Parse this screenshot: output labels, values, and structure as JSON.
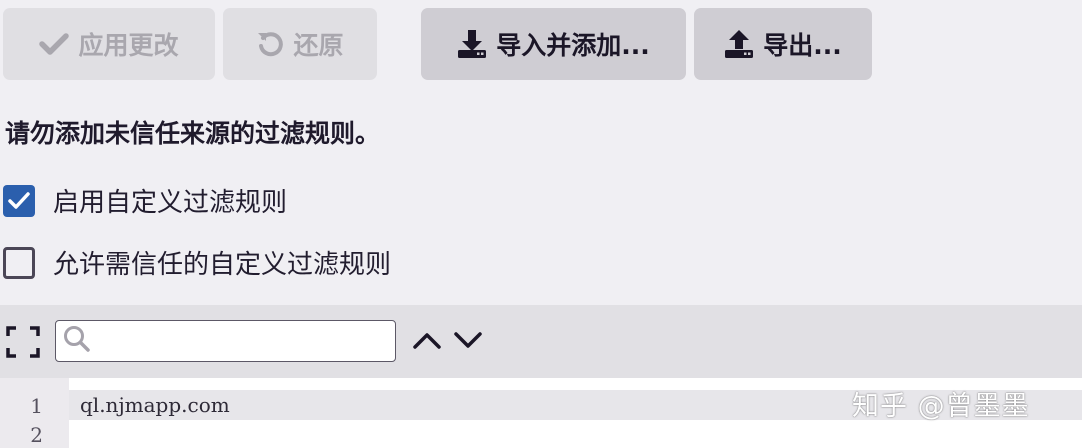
{
  "toolbar": {
    "apply": {
      "label": "应用更改",
      "icon": "check-icon",
      "state": "disabled"
    },
    "revert": {
      "label": "还原",
      "icon": "undo-icon",
      "state": "disabled"
    },
    "import": {
      "label": "导入并添加...",
      "icon": "download-icon",
      "state": "enabled"
    },
    "export": {
      "label": "导出...",
      "icon": "upload-icon",
      "state": "enabled"
    }
  },
  "warning": "请勿添加未信任来源的过滤规则。",
  "options": [
    {
      "label": "启用自定义过滤规则",
      "checked": true
    },
    {
      "label": "允许需信任的自定义过滤规则",
      "checked": false
    }
  ],
  "editor_toolbar": {
    "fullscreen_icon": "expand-icon",
    "search_placeholder": "",
    "search_value": "",
    "search_icon": "search-icon",
    "prev_icon": "chevron-up-icon",
    "next_icon": "chevron-down-icon"
  },
  "editor": {
    "lines": [
      {
        "number": "1",
        "text": "ql.njmapp.com"
      },
      {
        "number": "2",
        "text": ""
      }
    ]
  },
  "watermark": "知乎 @曾墨墨",
  "colors": {
    "page_bg": "#f0eff3",
    "button_active_bg": "#cfcdd3",
    "button_disabled_bg": "#e0dfe3",
    "checkbox_checked": "#2b5fad",
    "editor_toolbar_bg": "#e1e0e4",
    "active_line_bg": "#e7e6ea"
  }
}
